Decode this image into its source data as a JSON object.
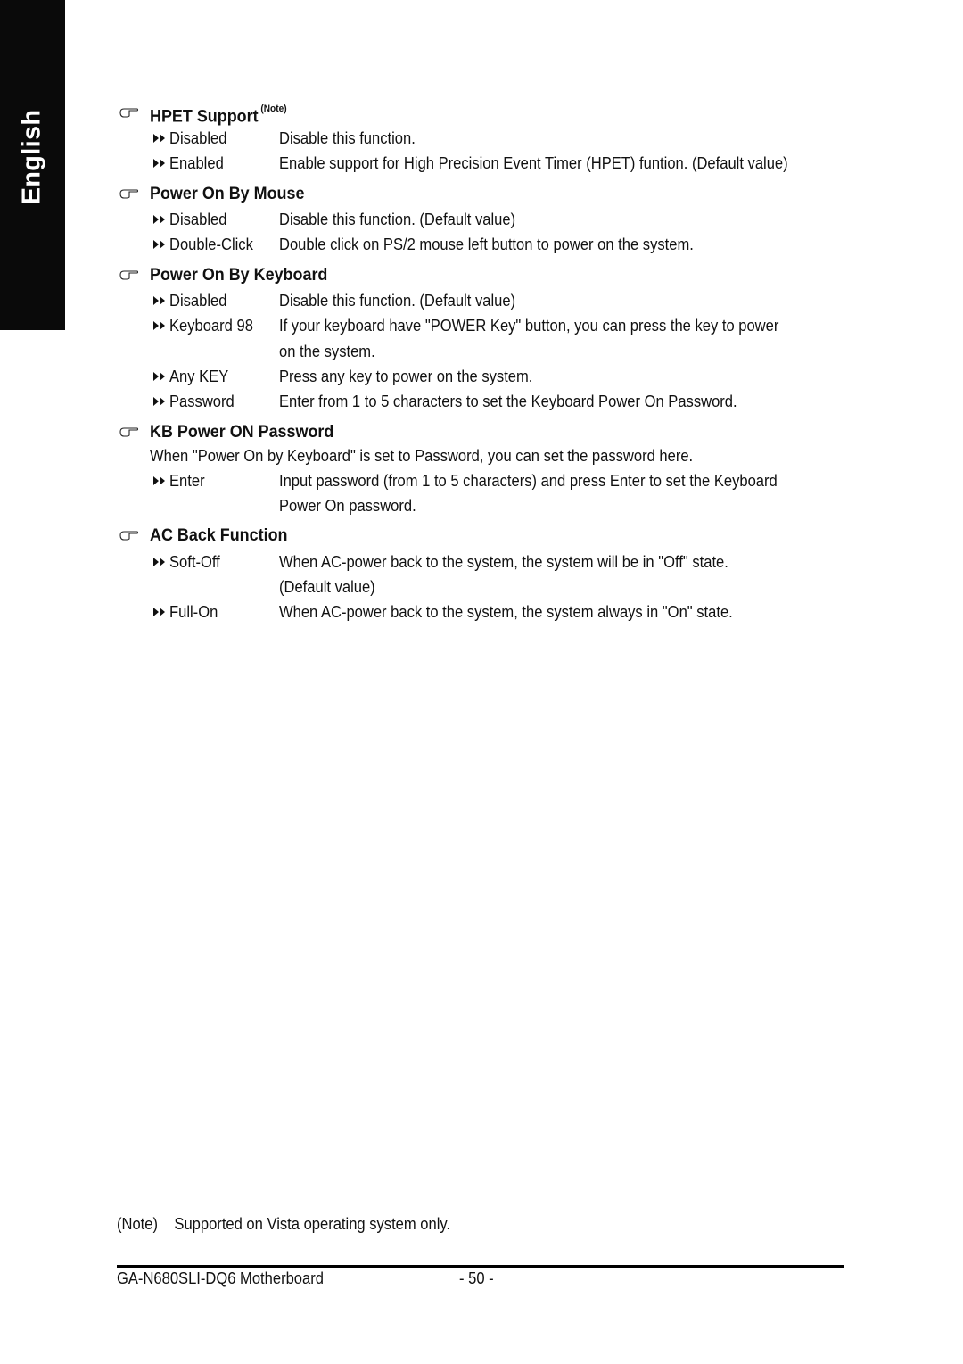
{
  "side_tab": {
    "label": "English",
    "background": "#0a0a0a",
    "text_color": "#ffffff"
  },
  "sections": [
    {
      "title": "HPET Support",
      "superscript": "(Note)",
      "options": [
        {
          "name": "Disabled",
          "description": [
            "Disable this function."
          ]
        },
        {
          "name": "Enabled",
          "description": [
            "Enable support for High Precision Event Timer (HPET) funtion. (Default value)"
          ]
        }
      ]
    },
    {
      "title": "Power On By Mouse",
      "options": [
        {
          "name": "Disabled",
          "description": [
            "Disable this function. (Default value)"
          ]
        },
        {
          "name": "Double-Click",
          "description": [
            "Double click on PS/2 mouse left button to power on the system."
          ]
        }
      ]
    },
    {
      "title": "Power On By Keyboard",
      "options": [
        {
          "name": "Disabled",
          "description": [
            "Disable this function. (Default value)"
          ]
        },
        {
          "name": "Keyboard 98",
          "description": [
            "If your keyboard have \"POWER Key\" button, you can press the key to power",
            "on the system."
          ]
        },
        {
          "name": "Any KEY",
          "description": [
            "Press any key to power on the system."
          ]
        },
        {
          "name": "Password",
          "description": [
            "Enter from 1 to 5 characters to set the Keyboard Power On Password."
          ]
        }
      ]
    },
    {
      "title": "KB Power ON Password",
      "intro": "When \"Power On by Keyboard\" is set to Password, you can set the password here.",
      "options": [
        {
          "name": "Enter",
          "description": [
            "Input password (from 1 to 5 characters) and press Enter to set the Keyboard",
            "Power On password."
          ]
        }
      ]
    },
    {
      "title": "AC Back Function",
      "options": [
        {
          "name": "Soft-Off",
          "description": [
            "When AC-power back to the system, the system will be in \"Off\" state.",
            "(Default value)"
          ]
        },
        {
          "name": "Full-On",
          "description": [
            "When AC-power back to the system, the system always in \"On\" state."
          ]
        }
      ]
    }
  ],
  "note": {
    "label": "(Note)",
    "text": "Supported on Vista operating system only."
  },
  "footer": {
    "model": "GA-N680SLI-DQ6 Motherboard",
    "page": "- 50 -"
  }
}
